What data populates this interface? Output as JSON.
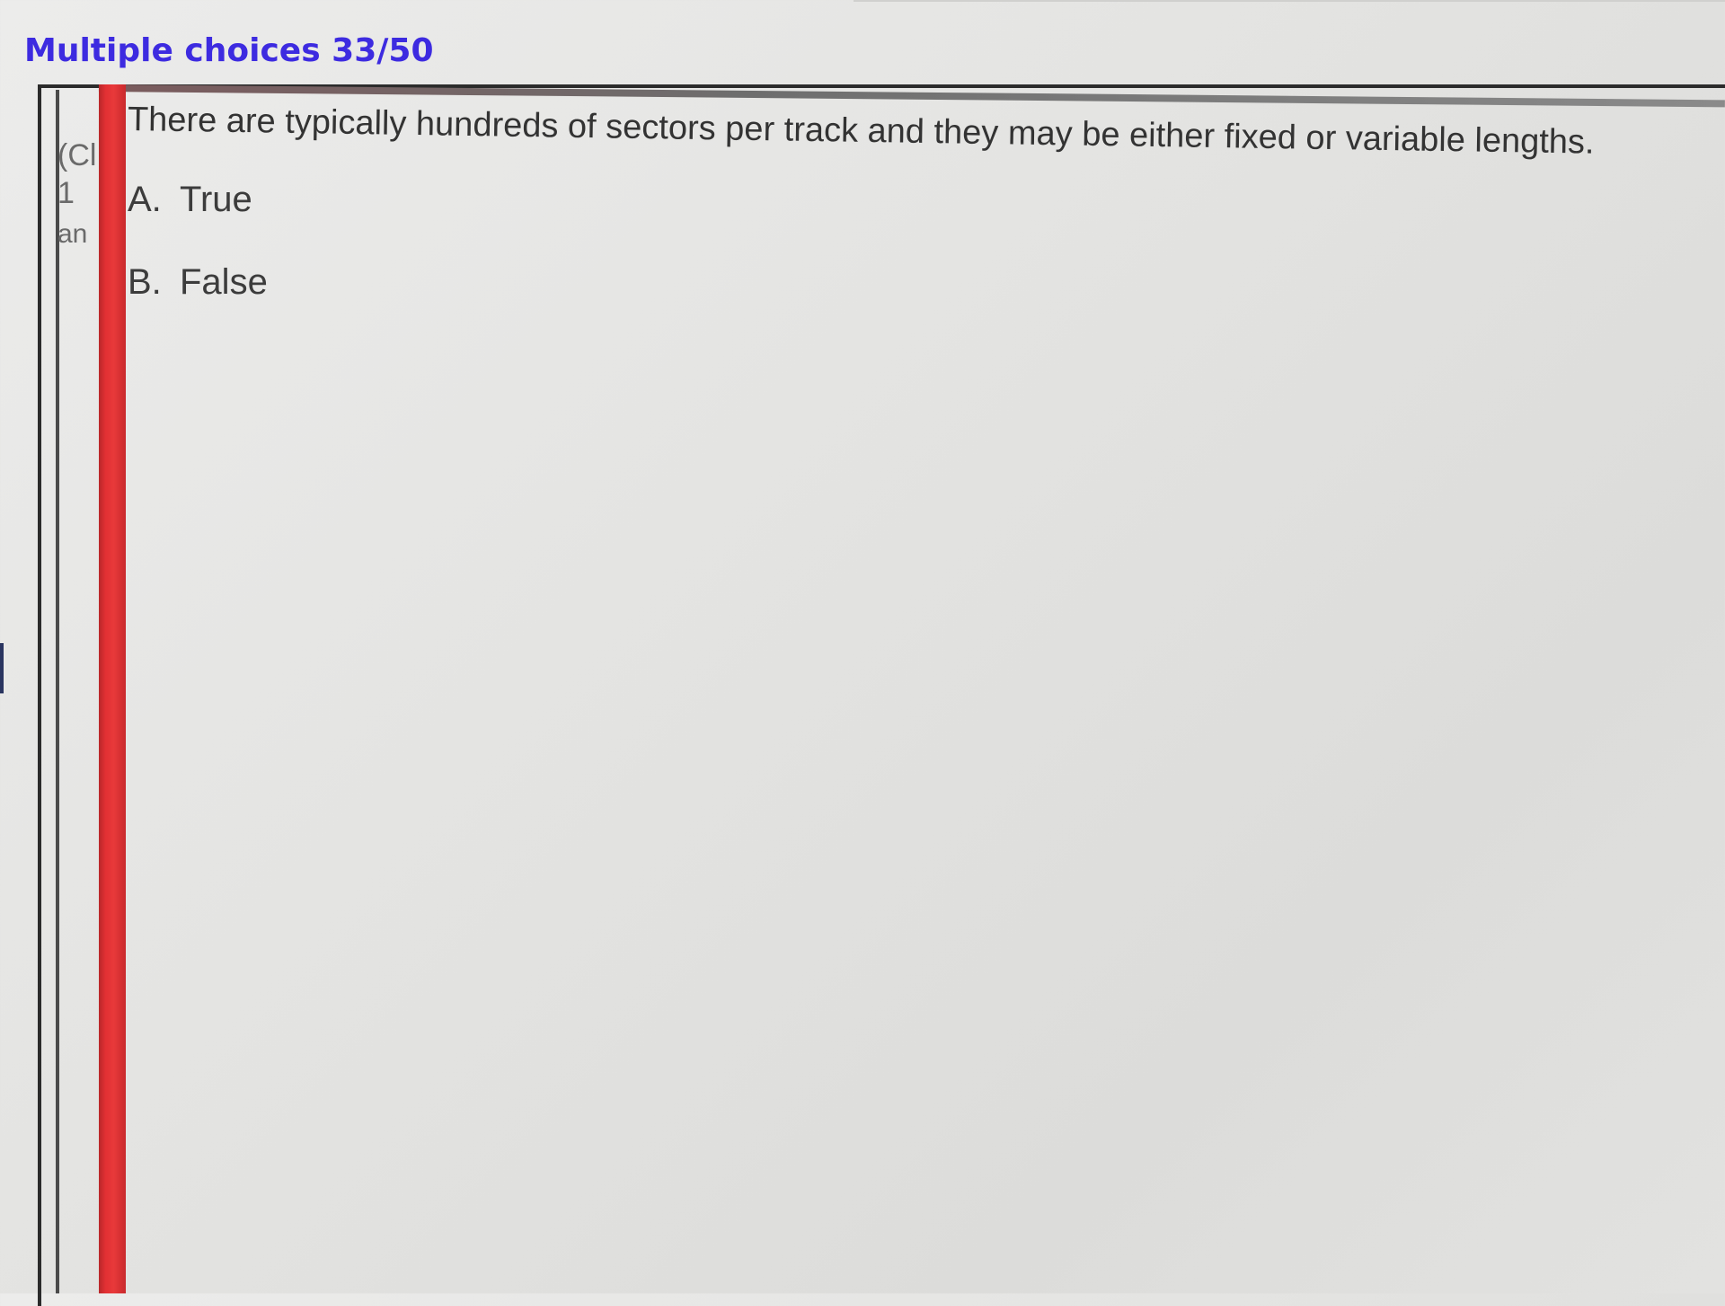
{
  "header": {
    "title": "Multiple choices 33/50"
  },
  "left_panel": {
    "fragments": [
      "(Cl",
      "1",
      "an"
    ]
  },
  "question": {
    "text": "There are typically hundreds of sectors per track and they may be either fixed or variable lengths.",
    "choices": [
      {
        "letter": "A.",
        "label": "True"
      },
      {
        "letter": "B.",
        "label": "False"
      }
    ]
  },
  "colors": {
    "title": "#3d2be0",
    "accent_bar": "#e23033",
    "text": "#333333"
  }
}
